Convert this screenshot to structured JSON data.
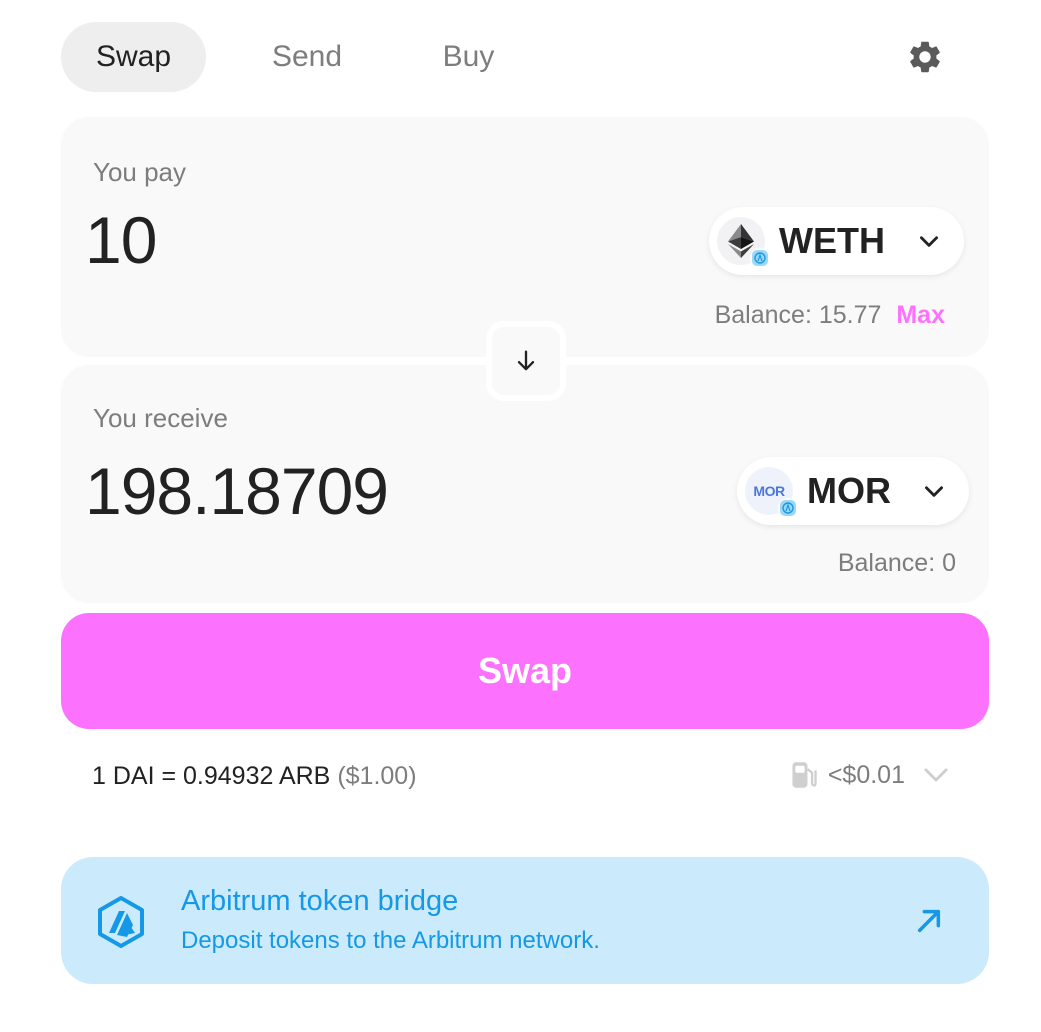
{
  "tabs": {
    "swap": "Swap",
    "send": "Send",
    "buy": "Buy",
    "settings_icon": "gear-icon"
  },
  "pay": {
    "label": "You pay",
    "amount": "10",
    "token": "WETH",
    "token_icon": "eth-icon",
    "balance_label": "Balance:",
    "balance_value": "15.77",
    "max_label": "Max"
  },
  "receive": {
    "label": "You receive",
    "amount": "198.18709",
    "token": "MOR",
    "token_logo_text": "MOR",
    "balance_label": "Balance:",
    "balance_value": "0"
  },
  "swap_button": {
    "label": "Swap",
    "color": "#fc72ff"
  },
  "rate": {
    "text": "1 DAI = 0.94932 ARB",
    "usd": "($1.00)"
  },
  "gas": {
    "value": "<$0.01",
    "icon": "gas-pump-icon"
  },
  "bridge": {
    "title": "Arbitrum token bridge",
    "subtitle": "Deposit tokens to the Arbitrum network.",
    "color": "#1599e6",
    "background": "#cbebfc"
  }
}
